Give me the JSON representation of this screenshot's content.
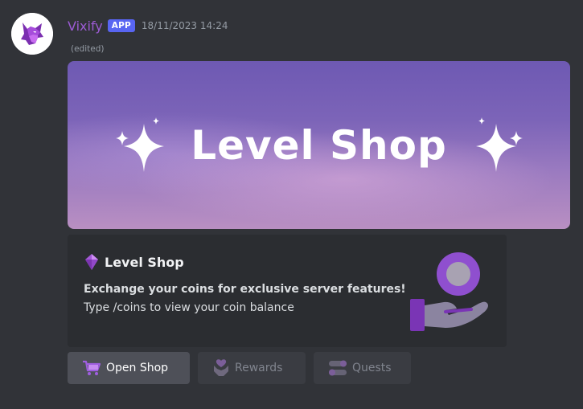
{
  "message": {
    "author": "Vixify",
    "badge": "APP",
    "timestamp": "18/11/2023 14:24",
    "edited": "(edited)"
  },
  "banner": {
    "title": "Level Shop"
  },
  "embed": {
    "title_icon": "purple-gem-icon",
    "title": "Level Shop",
    "description_bold": "Exchange your coins for exclusive server features!",
    "description": "Type /coins to view your coin balance",
    "thumbnail_icon": "coin-in-hand-icon"
  },
  "buttons": [
    {
      "label": "Open Shop",
      "icon": "shopping-cart-icon",
      "disabled": false
    },
    {
      "label": "Rewards",
      "icon": "heart-hands-icon",
      "disabled": true
    },
    {
      "label": "Quests",
      "icon": "quest-toggles-icon",
      "disabled": true
    }
  ],
  "colors": {
    "background": "#313338",
    "username": "#9c5bd4",
    "badge": "#5865f2",
    "embed": "#2b2d31",
    "accent_purple": "#7b3fb8"
  }
}
